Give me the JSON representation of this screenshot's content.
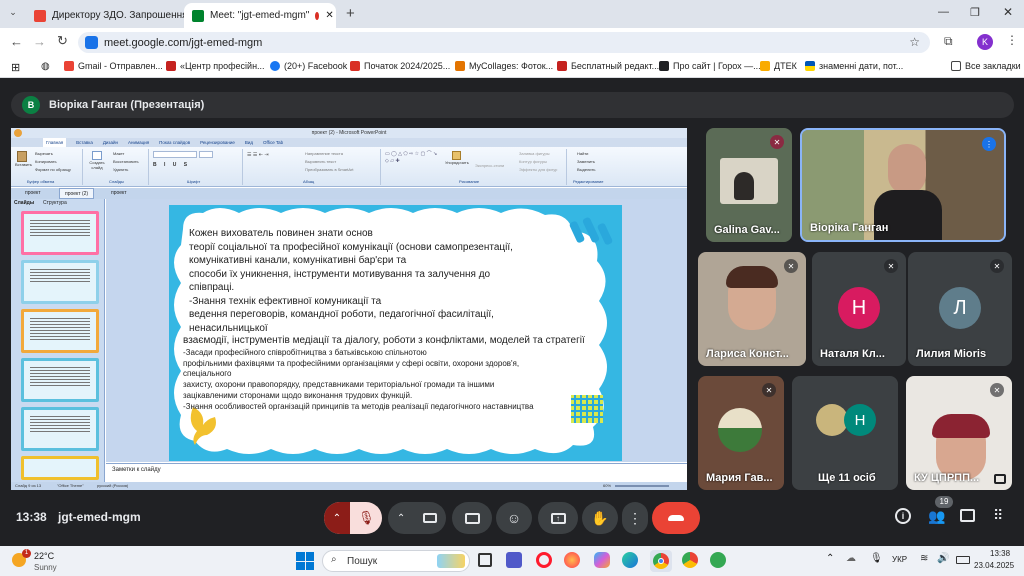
{
  "browser": {
    "tabs": [
      {
        "label": "Директору ЗДО. Запрошення",
        "color": "#ea4335"
      },
      {
        "label": "Meet: \"jgt-emed-mgm\"",
        "color": "#00832d"
      }
    ],
    "new_tab": "+",
    "url": "meet.google.com/jgt-emed-mgm",
    "profile_initial": "K",
    "bookmarks": [
      {
        "label": "Gmail - Отправлен...",
        "color": "#ea4335"
      },
      {
        "label": "«Центр професійн...",
        "color": "#c5221f"
      },
      {
        "label": "(20+) Facebook",
        "color": "#1877f2"
      },
      {
        "label": "Початок 2024/2025...",
        "color": "#d93025"
      },
      {
        "label": "MyCollages: Фоток...",
        "color": "#e37400"
      },
      {
        "label": "Бесплатный редакт...",
        "color": "#c5221f"
      },
      {
        "label": "Про сайт | Горох —...",
        "color": "#202124"
      },
      {
        "label": "ДТЕК",
        "color": "#f9ab00"
      },
      {
        "label": "знаменні дати, пот...",
        "color": "#1a73e8"
      }
    ],
    "all_bookmarks": "Все закладки"
  },
  "meet": {
    "presenter_initial": "В",
    "presenter_label": "Віоріка Ганган (Презентація)",
    "participants": [
      {
        "name": "Galina Gav...",
        "muted": true
      },
      {
        "name": "Віоріка Ганган",
        "muted": false
      },
      {
        "name": "Лариса Конст...",
        "muted": true
      },
      {
        "name": "Наталя Кл...",
        "initial": "Н",
        "color": "#d81b60",
        "muted": true
      },
      {
        "name": "Лилия Mioris",
        "initial": "Л",
        "color": "#5f7d8b",
        "muted": true
      },
      {
        "name": "Мария Гав...",
        "muted": true
      },
      {
        "name": "Ще 11 осіб",
        "initial": "Н",
        "color": "#00897b"
      },
      {
        "name": "КУ ЦПРПП...",
        "muted": true
      }
    ],
    "time": "13:38",
    "meeting_code": "jgt-emed-mgm",
    "people_count": "19",
    "accent_red": "#ea4335"
  },
  "ppt": {
    "title": "проект (2) - Microsoft PowerPoint",
    "ribbon_tabs": [
      "Главная",
      "Вставка",
      "Дизайн",
      "Анимация",
      "Показ слайдов",
      "Рецензирование",
      "Вид",
      "Office Tab"
    ],
    "groups": [
      "Буфер обмена",
      "Слайды",
      "Шрифт",
      "Абзац",
      "Рисование",
      "Редактирование"
    ],
    "clipboard": [
      "Вставить",
      "Вырезать",
      "Копировать",
      "Формат по образцу"
    ],
    "slides_group": [
      "Создать слайд",
      "Макет",
      "Восстановить",
      "Удалить"
    ],
    "paragraph_btns": [
      "Направление текста",
      "Выровнять текст",
      "Преобразовать в SmartArt"
    ],
    "drawing_btns": [
      "Упорядочить",
      "Экспресс-стили",
      "Заливка фигуры",
      "Контур фигуры",
      "Эффекты для фигур"
    ],
    "editing_btns": [
      "Найти",
      "Заменить",
      "Выделить"
    ],
    "doc_tabs": [
      "проект",
      "проект (2)",
      "проект"
    ],
    "panel_tabs": [
      "Слайды",
      "Структура"
    ],
    "slide_numbers": [
      "",
      "",
      "",
      "",
      "",
      ""
    ],
    "notes": "Заметки к слайду",
    "status": [
      "Слайд 9 из 13",
      "\"Office Theme\"",
      "русский (Россия)",
      "60%"
    ],
    "slide_lines": [
      "Кожен вихователь повинен знати основ",
      "теорії   соціальної та     професійної комунікації (основи самопрезентації,",
      "комунікативні  канали, комунікативні бар'єри  та",
      "способи  їх уникнення, інструменти мотивування та залучення до",
      "співпраці.",
      "-Знання технік  ефективної комуникації та",
      "ведення переговорів, командної роботи, педагогічної фасилітації,",
      "ненасильницької",
      "взаємодії, інструментів медіації та діалогу, роботи з конфліктами, моделей та стратегії",
      "-Засади професійного співробітництва з батьківською спільнотою",
      "профільними фахівцями та професійними організаціями     у сфері  освіти, охорони здоров'я,",
      "спеціального",
      "захисту,  охорони правопорядку, представниками територіальної громади та іншими",
      "зацікавленими сторонами    щодо виконання трудових функцій.",
      "-Знання особливостей організацій принципів та методів реалізації педагогічного наставництва"
    ]
  },
  "taskbar": {
    "weather_temp": "22°C",
    "weather_desc": "Sunny",
    "weather_badge": "1",
    "search_placeholder": "Пошук",
    "lang": "УКР",
    "clock_time": "13:38",
    "clock_date": "23.04.2025"
  }
}
